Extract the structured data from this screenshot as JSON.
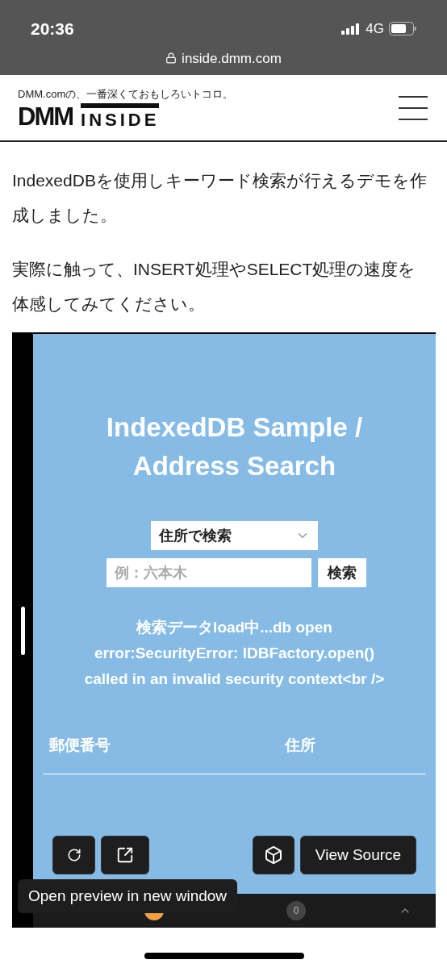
{
  "status_bar": {
    "time": "20:36",
    "network": "4G"
  },
  "address_bar": {
    "url": "inside.dmm.com"
  },
  "site_header": {
    "tagline": "DMM.comの、一番深くておもしろいトコロ。",
    "logo_left": "DMM",
    "logo_right": "INSIDE"
  },
  "article": {
    "paragraphs": [
      "IndexedDBを使用しキーワード検索が行えるデモを作成しました。",
      "実際に触って、INSERT処理やSELECT処理の速度を体感してみてください。"
    ]
  },
  "demo": {
    "title_lines": [
      "IndexedDB Sample /",
      "Address Search"
    ],
    "select": {
      "value": "住所で検索"
    },
    "search_field": {
      "placeholder": "例：六本木"
    },
    "search_button": "検索",
    "message_lines": [
      "検索データload中...db open",
      "error:SecurityError: IDBFactory.open()",
      "called in an invalid security context<br />"
    ],
    "table": {
      "columns": [
        "郵便番号",
        "住所"
      ]
    }
  },
  "toolbar": {
    "buttons": [
      {
        "kind": "refresh"
      },
      {
        "kind": "open-window"
      },
      {
        "kind": "sandbox"
      },
      {
        "kind": "text",
        "label": "View Source"
      }
    ]
  },
  "tooltip": "Open preview in new window",
  "bottom_panel": {
    "problems_count": "0"
  }
}
